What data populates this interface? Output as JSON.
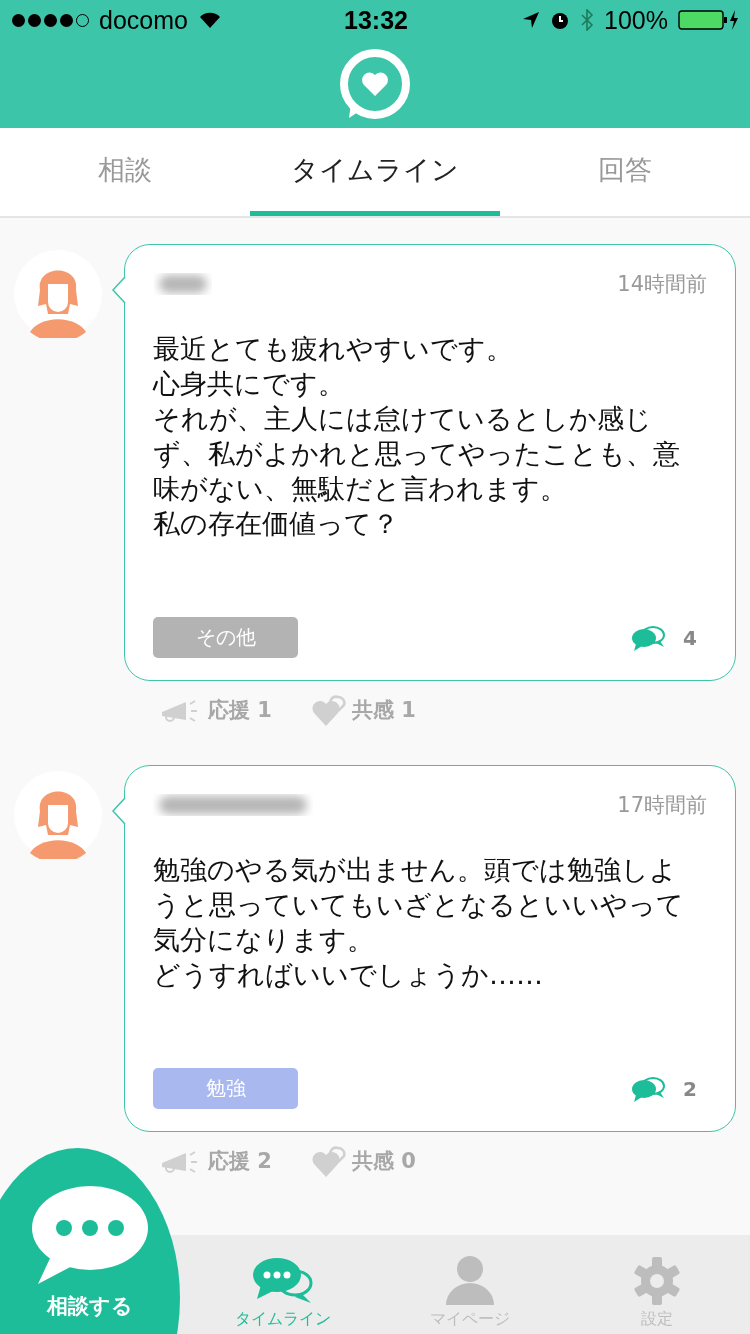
{
  "status_bar": {
    "carrier": "docomo",
    "time": "13:32",
    "battery": "100%"
  },
  "tabs": [
    {
      "label": "相談",
      "selected": false
    },
    {
      "label": "タイムライン",
      "selected": true
    },
    {
      "label": "回答",
      "selected": false
    }
  ],
  "posts": [
    {
      "time": "14時間前",
      "lines": [
        "最近とても疲れやすいです。",
        "心身共にです。",
        "それが、主人には怠けているとしか感じず、私がよかれと思ってやったことも、意味がない、無駄だと言われます。",
        "私の存在価値って？"
      ],
      "tag": {
        "label": "その他",
        "color": "#b3b3b3"
      },
      "comments": "4",
      "cheer": "応援 1",
      "empathy": "共感 1"
    },
    {
      "time": "17時間前",
      "lines": [
        "勉強のやる気が出ません。頭では勉強しようと思っていてもいざとなるといいやって気分になります。",
        "どうすればいいでしょうか……"
      ],
      "tag": {
        "label": "勉強",
        "color": "#a9b9f0"
      },
      "comments": "2",
      "cheer": "応援 2",
      "empathy": "共感 0"
    }
  ],
  "fab": {
    "label": "相談する"
  },
  "bottom_tabs": [
    {
      "label": "タイムライン",
      "kind": "chat",
      "selected": true
    },
    {
      "label": "マイページ",
      "kind": "person",
      "selected": false
    },
    {
      "label": "設定",
      "kind": "gear",
      "selected": false
    }
  ]
}
